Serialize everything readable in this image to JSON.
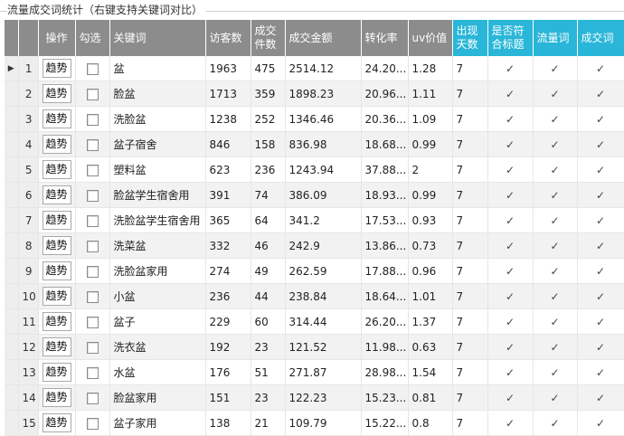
{
  "title": "流量成交词统计（右键支持关键词对比）",
  "columns": {
    "action": "操作",
    "select": "勾选",
    "keyword": "关键词",
    "visitors": "访客数",
    "orders": "成交件数",
    "amount": "成交金额",
    "conversion": "转化率",
    "uv_value": "uv价值",
    "days": "出现天数",
    "title_match": "是否符合标题",
    "traffic_word": "流量词",
    "deal_word": "成交词"
  },
  "trend_label": "趋势",
  "check_mark": "✓",
  "active_row_marker": "▶",
  "rows": [
    {
      "num": "1",
      "keyword": "盆",
      "visitors": "1963",
      "orders": "475",
      "amount": "2514.12",
      "conversion": "24.20...",
      "uv": "1.28",
      "days": "7"
    },
    {
      "num": "2",
      "keyword": "脸盆",
      "visitors": "1713",
      "orders": "359",
      "amount": "1898.23",
      "conversion": "20.96...",
      "uv": "1.11",
      "days": "7"
    },
    {
      "num": "3",
      "keyword": "洗脸盆",
      "visitors": "1238",
      "orders": "252",
      "amount": "1346.46",
      "conversion": "20.36...",
      "uv": "1.09",
      "days": "7"
    },
    {
      "num": "4",
      "keyword": "盆子宿舍",
      "visitors": "846",
      "orders": "158",
      "amount": "836.98",
      "conversion": "18.68...",
      "uv": "0.99",
      "days": "7"
    },
    {
      "num": "5",
      "keyword": "塑料盆",
      "visitors": "623",
      "orders": "236",
      "amount": "1243.94",
      "conversion": "37.88...",
      "uv": "2",
      "days": "7"
    },
    {
      "num": "6",
      "keyword": "脸盆学生宿舍用",
      "visitors": "391",
      "orders": "74",
      "amount": "386.09",
      "conversion": "18.93...",
      "uv": "0.99",
      "days": "7"
    },
    {
      "num": "7",
      "keyword": "洗脸盆学生宿舍用",
      "visitors": "365",
      "orders": "64",
      "amount": "341.2",
      "conversion": "17.53...",
      "uv": "0.93",
      "days": "7"
    },
    {
      "num": "8",
      "keyword": "洗菜盆",
      "visitors": "332",
      "orders": "46",
      "amount": "242.9",
      "conversion": "13.86...",
      "uv": "0.73",
      "days": "7"
    },
    {
      "num": "9",
      "keyword": "洗脸盆家用",
      "visitors": "274",
      "orders": "49",
      "amount": "262.59",
      "conversion": "17.88...",
      "uv": "0.96",
      "days": "7"
    },
    {
      "num": "10",
      "keyword": "小盆",
      "visitors": "236",
      "orders": "44",
      "amount": "238.84",
      "conversion": "18.64...",
      "uv": "1.01",
      "days": "7"
    },
    {
      "num": "11",
      "keyword": "盆子",
      "visitors": "229",
      "orders": "60",
      "amount": "314.44",
      "conversion": "26.20...",
      "uv": "1.37",
      "days": "7"
    },
    {
      "num": "12",
      "keyword": "洗衣盆",
      "visitors": "192",
      "orders": "23",
      "amount": "121.52",
      "conversion": "11.98...",
      "uv": "0.63",
      "days": "7"
    },
    {
      "num": "13",
      "keyword": "水盆",
      "visitors": "176",
      "orders": "51",
      "amount": "271.87",
      "conversion": "28.98...",
      "uv": "1.54",
      "days": "7"
    },
    {
      "num": "14",
      "keyword": "脸盆家用",
      "visitors": "151",
      "orders": "23",
      "amount": "122.23",
      "conversion": "15.23...",
      "uv": "0.81",
      "days": "7"
    },
    {
      "num": "15",
      "keyword": "盆子家用",
      "visitors": "138",
      "orders": "21",
      "amount": "109.79",
      "conversion": "15.22...",
      "uv": "0.8",
      "days": "7"
    }
  ]
}
